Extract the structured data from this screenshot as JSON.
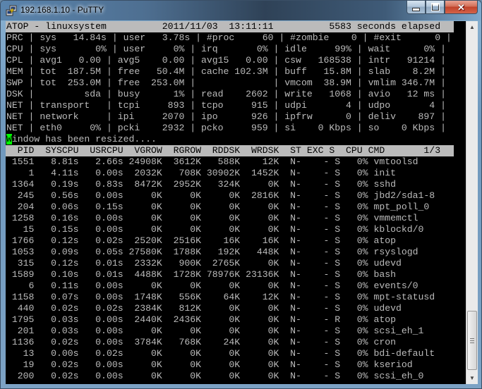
{
  "window": {
    "title": "192.168.1.10 - PuTTY",
    "icon": "putty-icon",
    "buttons": {
      "minimize": "minimize-icon",
      "maximize": "maximize-icon",
      "close": "close-icon"
    }
  },
  "terminal": {
    "header": "ATOP - linuxsystem          2011/11/03  13:11:11          5583 seconds elapsed",
    "system_lines": [
      "PRC | sys   14.84s | user   3.78s | #proc     60 | #zombie    0 | #exit      0 |",
      "CPU | sys       0% | user     0% | irq       0% | idle     99% | wait      0% |",
      "CPL | avg1   0.00 | avg5    0.00 | avg15   0.00 | csw   168538 | intr   91214 |",
      "MEM | tot  187.5M | free   50.4M | cache 102.3M | buff   15.8M | slab    8.2M |",
      "SWP | tot  253.0M | free  253.0M |              | vmcom  38.9M | vmlim 346.7M |",
      "DSK |         sda | busy      1% | read    2602 | write   1068 | avio   12 ms |",
      "NET | transport   | tcpi     893 | tcpo     915 | udpi       4 | udpo       4 |",
      "NET | network     | ipi     2070 | ipo      926 | ipfrw      0 | deliv    897 |",
      "NET | eth0     0% | pcki    2932 | pcko     959 | si    0 Kbps | so    0 Kbps |"
    ],
    "message_cursor_char": "W",
    "message_rest": "indow has been resized....",
    "process_header": "  PID  SYSCPU  USRCPU  VGROW  RGROW  RDDSK  WRDSK  ST EXC S  CPU CMD       1/3",
    "process_columns": [
      "PID",
      "SYSCPU",
      "USRCPU",
      "VGROW",
      "RGROW",
      "RDDSK",
      "WRDSK",
      "ST",
      "EXC",
      "S",
      "CPU",
      "CMD"
    ],
    "page_indicator": "1/3",
    "processes": [
      {
        "pid": "1551",
        "syscpu": "8.81s",
        "usrcpu": "2.66s",
        "vgrow": "24908K",
        "rgrow": "3612K",
        "rddsk": "588K",
        "wrdsk": "12K",
        "st": "N-",
        "exc": "-",
        "s": "S",
        "cpu": "0%",
        "cmd": "vmtoolsd"
      },
      {
        "pid": "1",
        "syscpu": "4.11s",
        "usrcpu": "0.00s",
        "vgrow": "2032K",
        "rgrow": "708K",
        "rddsk": "30902K",
        "wrdsk": "1452K",
        "st": "N-",
        "exc": "-",
        "s": "S",
        "cpu": "0%",
        "cmd": "init"
      },
      {
        "pid": "1364",
        "syscpu": "0.19s",
        "usrcpu": "0.83s",
        "vgrow": "8472K",
        "rgrow": "2952K",
        "rddsk": "324K",
        "wrdsk": "0K",
        "st": "N-",
        "exc": "-",
        "s": "S",
        "cpu": "0%",
        "cmd": "sshd"
      },
      {
        "pid": "245",
        "syscpu": "0.56s",
        "usrcpu": "0.00s",
        "vgrow": "0K",
        "rgrow": "0K",
        "rddsk": "0K",
        "wrdsk": "2816K",
        "st": "N-",
        "exc": "-",
        "s": "S",
        "cpu": "0%",
        "cmd": "jbd2/sda1-8"
      },
      {
        "pid": "204",
        "syscpu": "0.06s",
        "usrcpu": "0.15s",
        "vgrow": "0K",
        "rgrow": "0K",
        "rddsk": "0K",
        "wrdsk": "0K",
        "st": "N-",
        "exc": "-",
        "s": "S",
        "cpu": "0%",
        "cmd": "mpt_poll_0"
      },
      {
        "pid": "1258",
        "syscpu": "0.16s",
        "usrcpu": "0.00s",
        "vgrow": "0K",
        "rgrow": "0K",
        "rddsk": "0K",
        "wrdsk": "0K",
        "st": "N-",
        "exc": "-",
        "s": "S",
        "cpu": "0%",
        "cmd": "vmmemctl"
      },
      {
        "pid": "15",
        "syscpu": "0.15s",
        "usrcpu": "0.00s",
        "vgrow": "0K",
        "rgrow": "0K",
        "rddsk": "0K",
        "wrdsk": "0K",
        "st": "N-",
        "exc": "-",
        "s": "S",
        "cpu": "0%",
        "cmd": "kblockd/0"
      },
      {
        "pid": "1766",
        "syscpu": "0.12s",
        "usrcpu": "0.02s",
        "vgrow": "2520K",
        "rgrow": "2516K",
        "rddsk": "16K",
        "wrdsk": "16K",
        "st": "N-",
        "exc": "-",
        "s": "S",
        "cpu": "0%",
        "cmd": "atop"
      },
      {
        "pid": "1053",
        "syscpu": "0.09s",
        "usrcpu": "0.05s",
        "vgrow": "27580K",
        "rgrow": "1788K",
        "rddsk": "192K",
        "wrdsk": "448K",
        "st": "N-",
        "exc": "-",
        "s": "S",
        "cpu": "0%",
        "cmd": "rsyslogd"
      },
      {
        "pid": "315",
        "syscpu": "0.12s",
        "usrcpu": "0.01s",
        "vgrow": "2332K",
        "rgrow": "900K",
        "rddsk": "2765K",
        "wrdsk": "0K",
        "st": "N-",
        "exc": "-",
        "s": "S",
        "cpu": "0%",
        "cmd": "udevd"
      },
      {
        "pid": "1589",
        "syscpu": "0.10s",
        "usrcpu": "0.01s",
        "vgrow": "4488K",
        "rgrow": "1728K",
        "rddsk": "78976K",
        "wrdsk": "23136K",
        "st": "N-",
        "exc": "-",
        "s": "S",
        "cpu": "0%",
        "cmd": "bash"
      },
      {
        "pid": "6",
        "syscpu": "0.11s",
        "usrcpu": "0.00s",
        "vgrow": "0K",
        "rgrow": "0K",
        "rddsk": "0K",
        "wrdsk": "0K",
        "st": "N-",
        "exc": "-",
        "s": "S",
        "cpu": "0%",
        "cmd": "events/0"
      },
      {
        "pid": "1158",
        "syscpu": "0.07s",
        "usrcpu": "0.00s",
        "vgrow": "1748K",
        "rgrow": "556K",
        "rddsk": "64K",
        "wrdsk": "12K",
        "st": "N-",
        "exc": "-",
        "s": "S",
        "cpu": "0%",
        "cmd": "mpt-statusd"
      },
      {
        "pid": "440",
        "syscpu": "0.02s",
        "usrcpu": "0.02s",
        "vgrow": "2384K",
        "rgrow": "812K",
        "rddsk": "0K",
        "wrdsk": "0K",
        "st": "N-",
        "exc": "-",
        "s": "S",
        "cpu": "0%",
        "cmd": "udevd"
      },
      {
        "pid": "1795",
        "syscpu": "0.03s",
        "usrcpu": "0.00s",
        "vgrow": "2440K",
        "rgrow": "2436K",
        "rddsk": "0K",
        "wrdsk": "0K",
        "st": "N-",
        "exc": "-",
        "s": "R",
        "cpu": "0%",
        "cmd": "atop"
      },
      {
        "pid": "201",
        "syscpu": "0.03s",
        "usrcpu": "0.00s",
        "vgrow": "0K",
        "rgrow": "0K",
        "rddsk": "0K",
        "wrdsk": "0K",
        "st": "N-",
        "exc": "-",
        "s": "S",
        "cpu": "0%",
        "cmd": "scsi_eh_1"
      },
      {
        "pid": "1136",
        "syscpu": "0.02s",
        "usrcpu": "0.00s",
        "vgrow": "3784K",
        "rgrow": "768K",
        "rddsk": "24K",
        "wrdsk": "0K",
        "st": "N-",
        "exc": "-",
        "s": "S",
        "cpu": "0%",
        "cmd": "cron"
      },
      {
        "pid": "13",
        "syscpu": "0.00s",
        "usrcpu": "0.02s",
        "vgrow": "0K",
        "rgrow": "0K",
        "rddsk": "0K",
        "wrdsk": "0K",
        "st": "N-",
        "exc": "-",
        "s": "S",
        "cpu": "0%",
        "cmd": "bdi-default"
      },
      {
        "pid": "19",
        "syscpu": "0.02s",
        "usrcpu": "0.00s",
        "vgrow": "0K",
        "rgrow": "0K",
        "rddsk": "0K",
        "wrdsk": "0K",
        "st": "N-",
        "exc": "-",
        "s": "S",
        "cpu": "0%",
        "cmd": "kseriod"
      },
      {
        "pid": "200",
        "syscpu": "0.02s",
        "usrcpu": "0.00s",
        "vgrow": "0K",
        "rgrow": "0K",
        "rddsk": "0K",
        "wrdsk": "0K",
        "st": "N-",
        "exc": "-",
        "s": "S",
        "cpu": "0%",
        "cmd": "scsi_eh_0"
      }
    ]
  },
  "scrollbar": {
    "up_icon": "scroll-up-arrow-icon",
    "down_icon": "scroll-down-arrow-icon",
    "scroll_position": 1.0
  },
  "colors": {
    "terminal_bg": "#000000",
    "terminal_fg": "#bbbbbb",
    "highlight_bg": "#bbbbbb",
    "cursor": "#00ff00",
    "close_button": "#c7452c"
  }
}
